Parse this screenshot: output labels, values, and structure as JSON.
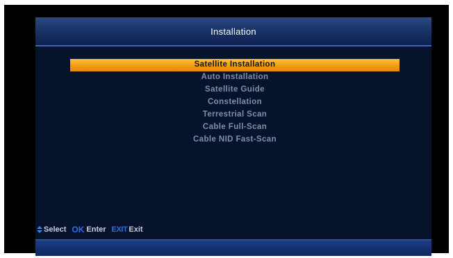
{
  "header": {
    "title": "Installation"
  },
  "menu": {
    "items": [
      {
        "label": "Satellite Installation",
        "selected": true
      },
      {
        "label": "Auto Installation",
        "selected": false
      },
      {
        "label": "Satellite Guide",
        "selected": false
      },
      {
        "label": "Constellation",
        "selected": false
      },
      {
        "label": "Terrestrial Scan",
        "selected": false
      },
      {
        "label": "Cable Full-Scan",
        "selected": false
      },
      {
        "label": "Cable NID Fast-Scan",
        "selected": false
      }
    ]
  },
  "footer": {
    "select_icon": "up-down-arrows-icon",
    "select_label": "Select",
    "ok_key": "OK",
    "ok_label": "Enter",
    "exit_key": "EXIT",
    "exit_label": "Exit"
  },
  "colors": {
    "background": "#07122b",
    "highlight": "#f29d12",
    "item_text": "#7f8fae",
    "key_blue": "#2c6df0",
    "header_border": "#3a66b5"
  }
}
